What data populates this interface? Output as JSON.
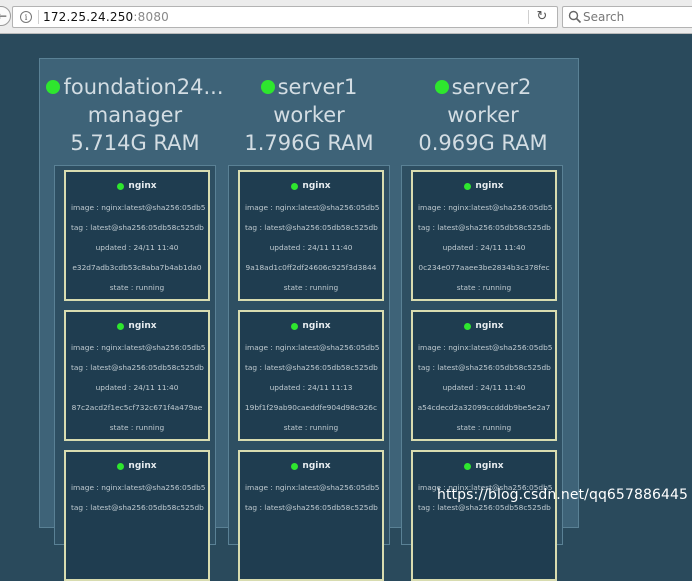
{
  "browser": {
    "back_icon": "back-arrow-icon",
    "url_host": "172.25.24.250",
    "url_port": ":8080",
    "search_placeholder": "Search"
  },
  "nodes": [
    {
      "name": "foundation24...",
      "role": "manager",
      "ram": "5.714G RAM",
      "tasks": [
        {
          "service": "nginx",
          "image": "image : nginx:latest@sha256:05db5",
          "tag": "tag : latest@sha256:05db58c525db",
          "updated": "updated : 24/11 11:40",
          "id": "e32d7adb3cdb53c8aba7b4ab1da0",
          "state": "state : running"
        },
        {
          "service": "nginx",
          "image": "image : nginx:latest@sha256:05db5",
          "tag": "tag : latest@sha256:05db58c525db",
          "updated": "updated : 24/11 11:40",
          "id": "87c2acd2f1ec5cf732c671f4a479ae",
          "state": "state : running"
        },
        {
          "service": "nginx",
          "image": "image : nginx:latest@sha256:05db5",
          "tag": "tag : latest@sha256:05db58c525db",
          "updated": "",
          "id": "",
          "state": ""
        }
      ]
    },
    {
      "name": "server1",
      "role": "worker",
      "ram": "1.796G RAM",
      "tasks": [
        {
          "service": "nginx",
          "image": "image : nginx:latest@sha256:05db5",
          "tag": "tag : latest@sha256:05db58c525db",
          "updated": "updated : 24/11 11:40",
          "id": "9a18ad1c0ff2df24606c925f3d3844",
          "state": "state : running"
        },
        {
          "service": "nginx",
          "image": "image : nginx:latest@sha256:05db5",
          "tag": "tag : latest@sha256:05db58c525db",
          "updated": "updated : 24/11 11:13",
          "id": "19bf1f29ab90caeddfe904d98c926c",
          "state": "state : running"
        },
        {
          "service": "nginx",
          "image": "image : nginx:latest@sha256:05db5",
          "tag": "tag : latest@sha256:05db58c525db",
          "updated": "",
          "id": "",
          "state": ""
        }
      ]
    },
    {
      "name": "server2",
      "role": "worker",
      "ram": "0.969G RAM",
      "tasks": [
        {
          "service": "nginx",
          "image": "image : nginx:latest@sha256:05db5",
          "tag": "tag : latest@sha256:05db58c525db",
          "updated": "updated : 24/11 11:40",
          "id": "0c234e077aaee3be2834b3c378fec",
          "state": "state : running"
        },
        {
          "service": "nginx",
          "image": "image : nginx:latest@sha256:05db5",
          "tag": "tag : latest@sha256:05db58c525db",
          "updated": "updated : 24/11 11:40",
          "id": "a54cdecd2a32099ccdddb9be5e2a7",
          "state": "state : running"
        },
        {
          "service": "nginx",
          "image": "image : nginx:latest@sha256:05db5",
          "tag": "tag : latest@sha256:05db58c525db",
          "updated": "",
          "id": "",
          "state": ""
        }
      ]
    }
  ],
  "colors": {
    "background": "#2a4a5c",
    "cluster": "#3e6378",
    "column": "#2e4f62",
    "task": "#1f3d50",
    "task_border": "#d8dcb0",
    "status_green": "#2ee62e"
  },
  "watermark": "https://blog.csdn.net/qq657886445"
}
